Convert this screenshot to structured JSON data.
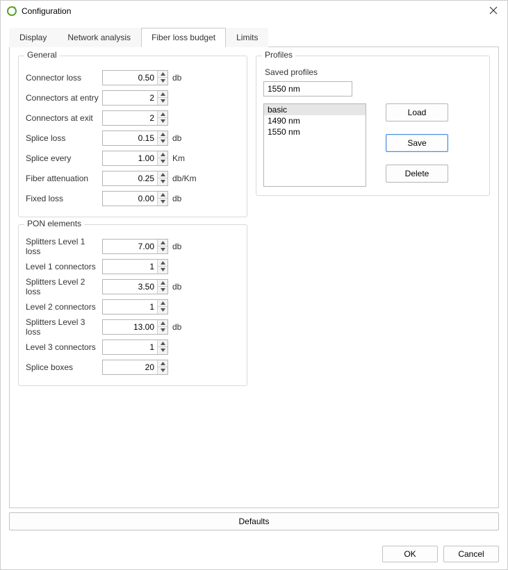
{
  "window": {
    "title": "Configuration"
  },
  "tabs": {
    "display": "Display",
    "network": "Network analysis",
    "fiber": "Fiber loss budget",
    "limits": "Limits",
    "active": "fiber"
  },
  "groups": {
    "general": "General",
    "profiles": "Profiles",
    "pon": "PON elements"
  },
  "general": {
    "connector_loss": {
      "label": "Connector loss",
      "value": "0.50",
      "unit": "db"
    },
    "connectors_entry": {
      "label": "Connectors at entry",
      "value": "2",
      "unit": ""
    },
    "connectors_exit": {
      "label": "Connectors at exit",
      "value": "2",
      "unit": ""
    },
    "splice_loss": {
      "label": "Splice loss",
      "value": "0.15",
      "unit": "db"
    },
    "splice_every": {
      "label": "Splice every",
      "value": "1.00",
      "unit": "Km"
    },
    "fiber_atten": {
      "label": "Fiber attenuation",
      "value": "0.25",
      "unit": "db/Km"
    },
    "fixed_loss": {
      "label": "Fixed loss",
      "value": "0.00",
      "unit": "db"
    }
  },
  "pon": {
    "spl1_loss": {
      "label": "Splitters Level 1 loss",
      "value": "7.00",
      "unit": "db"
    },
    "l1_conn": {
      "label": "Level 1 connectors",
      "value": "1",
      "unit": ""
    },
    "spl2_loss": {
      "label": "Splitters Level 2 loss",
      "value": "3.50",
      "unit": "db"
    },
    "l2_conn": {
      "label": "Level 2 connectors",
      "value": "1",
      "unit": ""
    },
    "spl3_loss": {
      "label": "Splitters Level 3 loss",
      "value": "13.00",
      "unit": "db"
    },
    "l3_conn": {
      "label": "Level 3 connectors",
      "value": "1",
      "unit": ""
    },
    "splice_box": {
      "label": "Splice boxes",
      "value": "20",
      "unit": ""
    }
  },
  "profiles": {
    "saved_label": "Saved profiles",
    "name_value": "1550 nm",
    "items": {
      "0": "basic",
      "1": "1490 nm",
      "2": "1550 nm"
    },
    "selected_index": 0,
    "buttons": {
      "load": "Load",
      "save": "Save",
      "delete": "Delete"
    }
  },
  "buttons": {
    "defaults": "Defaults",
    "ok": "OK",
    "cancel": "Cancel"
  }
}
